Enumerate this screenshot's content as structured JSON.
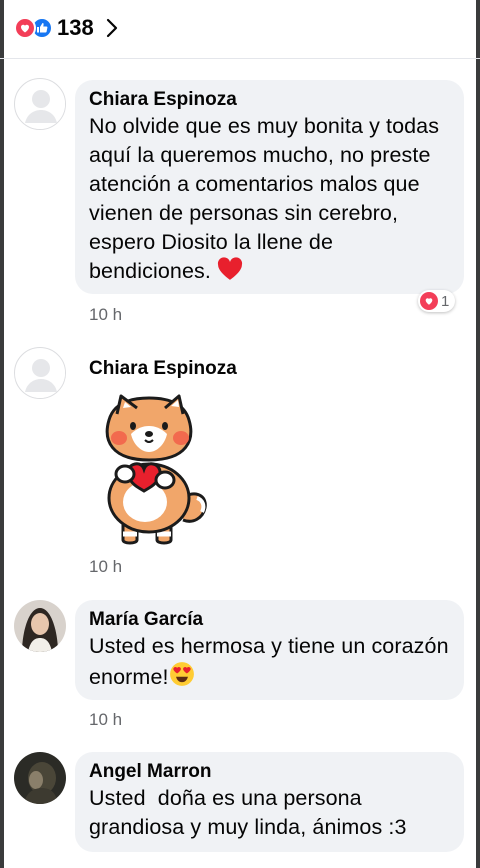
{
  "header": {
    "reaction_count": "138",
    "reaction_icons": [
      "love-icon",
      "like-icon"
    ]
  },
  "comments": [
    {
      "author": "Chiara Espinoza",
      "text": "No olvide que es muy bonita y todas aquí la queremos mucho, no preste atención a comentarios malos que vienen de personas sin cerebro, espero Diosito la llene de bendiciones. ",
      "emoji": "red-heart",
      "time": "10 h",
      "reactions": {
        "icon": "love-icon",
        "count": "1"
      }
    },
    {
      "author": "Chiara Espinoza",
      "sticker": "shiba-dog-holding-heart-sticker",
      "time": "10 h"
    },
    {
      "author": "María García",
      "text": "Usted es hermosa y tiene un corazón enorme!",
      "emoji": "heart-eyes",
      "time": "10 h"
    },
    {
      "author": "Angel Marron",
      "text": "Usted  doña es una persona grandiosa y muy linda, ánimos :3"
    }
  ],
  "colors": {
    "love": "#f33e58",
    "like": "#1877f2",
    "bubble": "#f0f2f5",
    "meta_text": "#65676b"
  }
}
